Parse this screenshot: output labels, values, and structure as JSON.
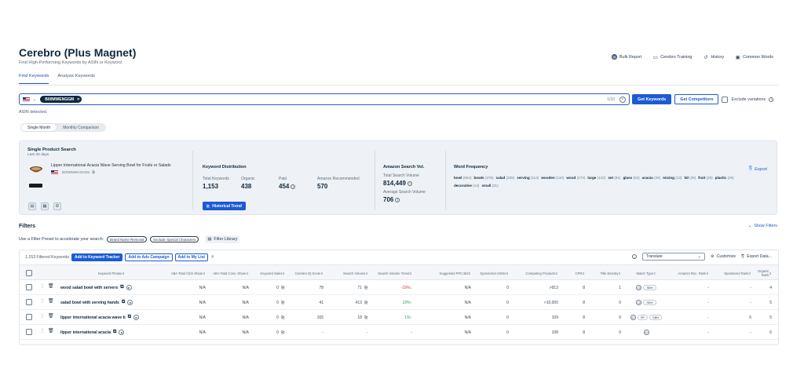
{
  "header": {
    "title": "Cerebro (Plus Magnet)",
    "subtitle": "Find High-Performing Keywords by ASIN or Keyword",
    "actions": [
      {
        "label": "Bulk Report",
        "icon": "bulk-report-icon"
      },
      {
        "label": "Cerebro Training",
        "icon": "training-icon"
      },
      {
        "label": "History",
        "icon": "history-icon"
      },
      {
        "label": "Common Words",
        "icon": "common-words-icon"
      }
    ]
  },
  "tabs": [
    "Find Keywords",
    "Analyze Keywords"
  ],
  "search": {
    "marketplace": "US",
    "asin_chip": "B00MWENGGM",
    "count": "1/10",
    "get_keywords": "Get Keywords",
    "get_competitors": "Get Competitors",
    "exclude_variations": "Exclude variations"
  },
  "asin_detected": "ASIN detected.",
  "mode_toggle": [
    "Single Month",
    "Monthly Comparison"
  ],
  "product_panel": {
    "title": "Single Product Search",
    "subtitle": "Last 30 days",
    "product_name": "Lipper International Acacia Wave Serving Bowl for Fruits or Salads",
    "product_asin": "B00MWENGGM",
    "keyword_distribution": {
      "title": "Keyword Distribution",
      "items": [
        {
          "label": "Total Keywords",
          "value": "1,153"
        },
        {
          "label": "Organic",
          "value": "438"
        },
        {
          "label": "Paid",
          "value": "454"
        },
        {
          "label": "Amazon Recommended",
          "value": "570"
        }
      ],
      "historical_trend": "Historical Trend"
    },
    "search_volume": {
      "title": "Amazon Search Vol.",
      "total_label": "Total Search Volume",
      "total_value": "814,449",
      "avg_label": "Average Search Volume",
      "avg_value": "706"
    },
    "word_frequency": {
      "title": "Word Frequency",
      "export": "Export",
      "line1": [
        {
          "w": "bowl",
          "n": "(664)"
        },
        {
          "w": "bowls",
          "n": "(279)"
        },
        {
          "w": "salad",
          "n": "(335)"
        },
        {
          "w": "serving",
          "n": "(114)"
        },
        {
          "w": "wooden",
          "n": "(110)"
        },
        {
          "w": "wood",
          "n": "(172)"
        },
        {
          "w": "large",
          "n": "(122)"
        },
        {
          "w": "set",
          "n": "(81)"
        },
        {
          "w": "glass",
          "n": "(62)"
        },
        {
          "w": "acacia",
          "n": "(28)"
        },
        {
          "w": "mixing",
          "n": "(13)"
        },
        {
          "w": "lid",
          "n": "(29)"
        },
        {
          "w": "fruit",
          "n": "(28)"
        },
        {
          "w": "plastic",
          "n": "(26)"
        }
      ],
      "line2": [
        {
          "w": "decorative",
          "n": "(14)"
        },
        {
          "w": "small",
          "n": "(21)"
        }
      ]
    }
  },
  "filters": {
    "title": "Filters",
    "show_filters": "Show Filters",
    "preset_text": "Use a Filter Preset to accelerate your search:",
    "presets": [
      "Brand Name Removal",
      "Exclude Special Characters"
    ],
    "filter_library": "Filter Library"
  },
  "table": {
    "filtered_count": "1,153 Filtered Keywords",
    "buttons": [
      "Add to Keyword Tracker",
      "Add to Ads Campaign",
      "Add to My List"
    ],
    "translate": "Translate",
    "customize": "Customize",
    "export": "Export Data...",
    "headers": [
      "Keyword Phrase",
      "ABA Total Click Share",
      "ABA Total Conv. Share",
      "Keyword Sales",
      "Cerebro IQ Score",
      "Search Volume",
      "Search Volume Trend",
      "Suggested PPC Bid",
      "Sponsored ASINs",
      "Competing Products",
      "CPR",
      "Title Density",
      "Match Type",
      "Amazon Rec. Rank",
      "Sponsored Rank",
      "Organic Rank"
    ],
    "rows": [
      {
        "kw": "wood salad bowl with servers",
        "click": "N/A",
        "conv": "N/A",
        "sales": "0",
        "iq": "78",
        "sv": "71",
        "trend": "-19%",
        "trend_dir": "down",
        "ppc": "N/A",
        "spons": "0",
        "comp": ">913",
        "cpr": "8",
        "td": "1",
        "match": [
          "O",
          "SBH"
        ],
        "rec": "-",
        "srank": "-",
        "orank": "4"
      },
      {
        "kw": "salad bowl with serving hands",
        "click": "N/A",
        "conv": "N/A",
        "sales": "0",
        "iq": "41",
        "sv": "413",
        "trend": "19%",
        "trend_dir": "up",
        "ppc": "N/A",
        "spons": "0",
        "comp": ">10,000",
        "cpr": "8",
        "td": "0",
        "match": [
          "O",
          "SBH"
        ],
        "rec": "-",
        "srank": "-",
        "orank": "5"
      },
      {
        "kw": "lipper international acacia wave b",
        "click": "N/A",
        "conv": "N/A",
        "sales": "0",
        "iq": "165",
        "sv": "18",
        "trend": "1%",
        "trend_dir": "up",
        "ppc": "N/A",
        "spons": "0",
        "comp": "109",
        "cpr": "8",
        "td": "0",
        "match": [
          "O",
          "SP",
          "SBH"
        ],
        "rec": "-",
        "srank": "6",
        "orank": "5"
      },
      {
        "kw": "lipper international acacia",
        "click": "N/A",
        "conv": "N/A",
        "sales": "0",
        "iq": "-",
        "sv": "-",
        "trend": "-",
        "trend_dir": "none",
        "ppc": "N/A",
        "spons": "0",
        "comp": "108",
        "cpr": "8",
        "td": "0",
        "match": [
          "O"
        ],
        "rec": "-",
        "srank": "-",
        "orank": "6"
      }
    ]
  },
  "colors": {
    "accent": "#1c5bd4",
    "title": "#0f2840",
    "panel_bg": "#eef2f6"
  }
}
